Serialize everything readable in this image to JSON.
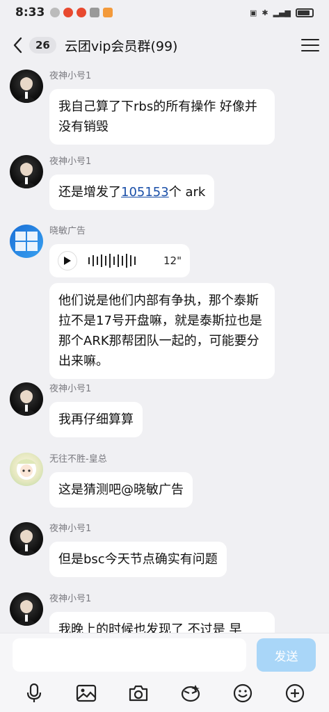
{
  "status": {
    "time": "8:33"
  },
  "header": {
    "unread_count": "26",
    "title": "云团vip会员群(99)"
  },
  "messages": [
    {
      "sender": "夜神小号1",
      "text": "我自己算了下rbs的所有操作 好像并没有销毁"
    },
    {
      "sender": "夜神小号1",
      "text_before": "还是增发了",
      "link": "105153",
      "text_after": "个 ark"
    },
    {
      "sender": "晓敏广告",
      "voice_duration": "12\"",
      "text": "他们说是他们内部有争执，那个泰斯拉不是17号开盘嘛，就是泰斯拉也是那个ARK那帮团队一起的，可能要分出来嘛。"
    },
    {
      "sender": "夜神小号1",
      "text": "我再仔细算算"
    },
    {
      "sender": "无往不胜-皇总",
      "text": "这是猜测吧@晓敏广告"
    },
    {
      "sender": "夜神小号1",
      "text": "但是bsc今天节点确实有问题"
    },
    {
      "sender": "夜神小号1",
      "text": "我晚上的时候也发现了 不过是 早"
    }
  ],
  "input": {
    "placeholder": "",
    "send_label": "发送"
  },
  "toolbar": [
    "microphone-icon",
    "image-icon",
    "camera-icon",
    "red-packet-icon",
    "emoji-icon",
    "plus-icon"
  ],
  "colors": {
    "background": "#f0f0f3",
    "bubble": "#ffffff",
    "send_button": "#a9d6f8",
    "link": "#1a4fa8"
  }
}
